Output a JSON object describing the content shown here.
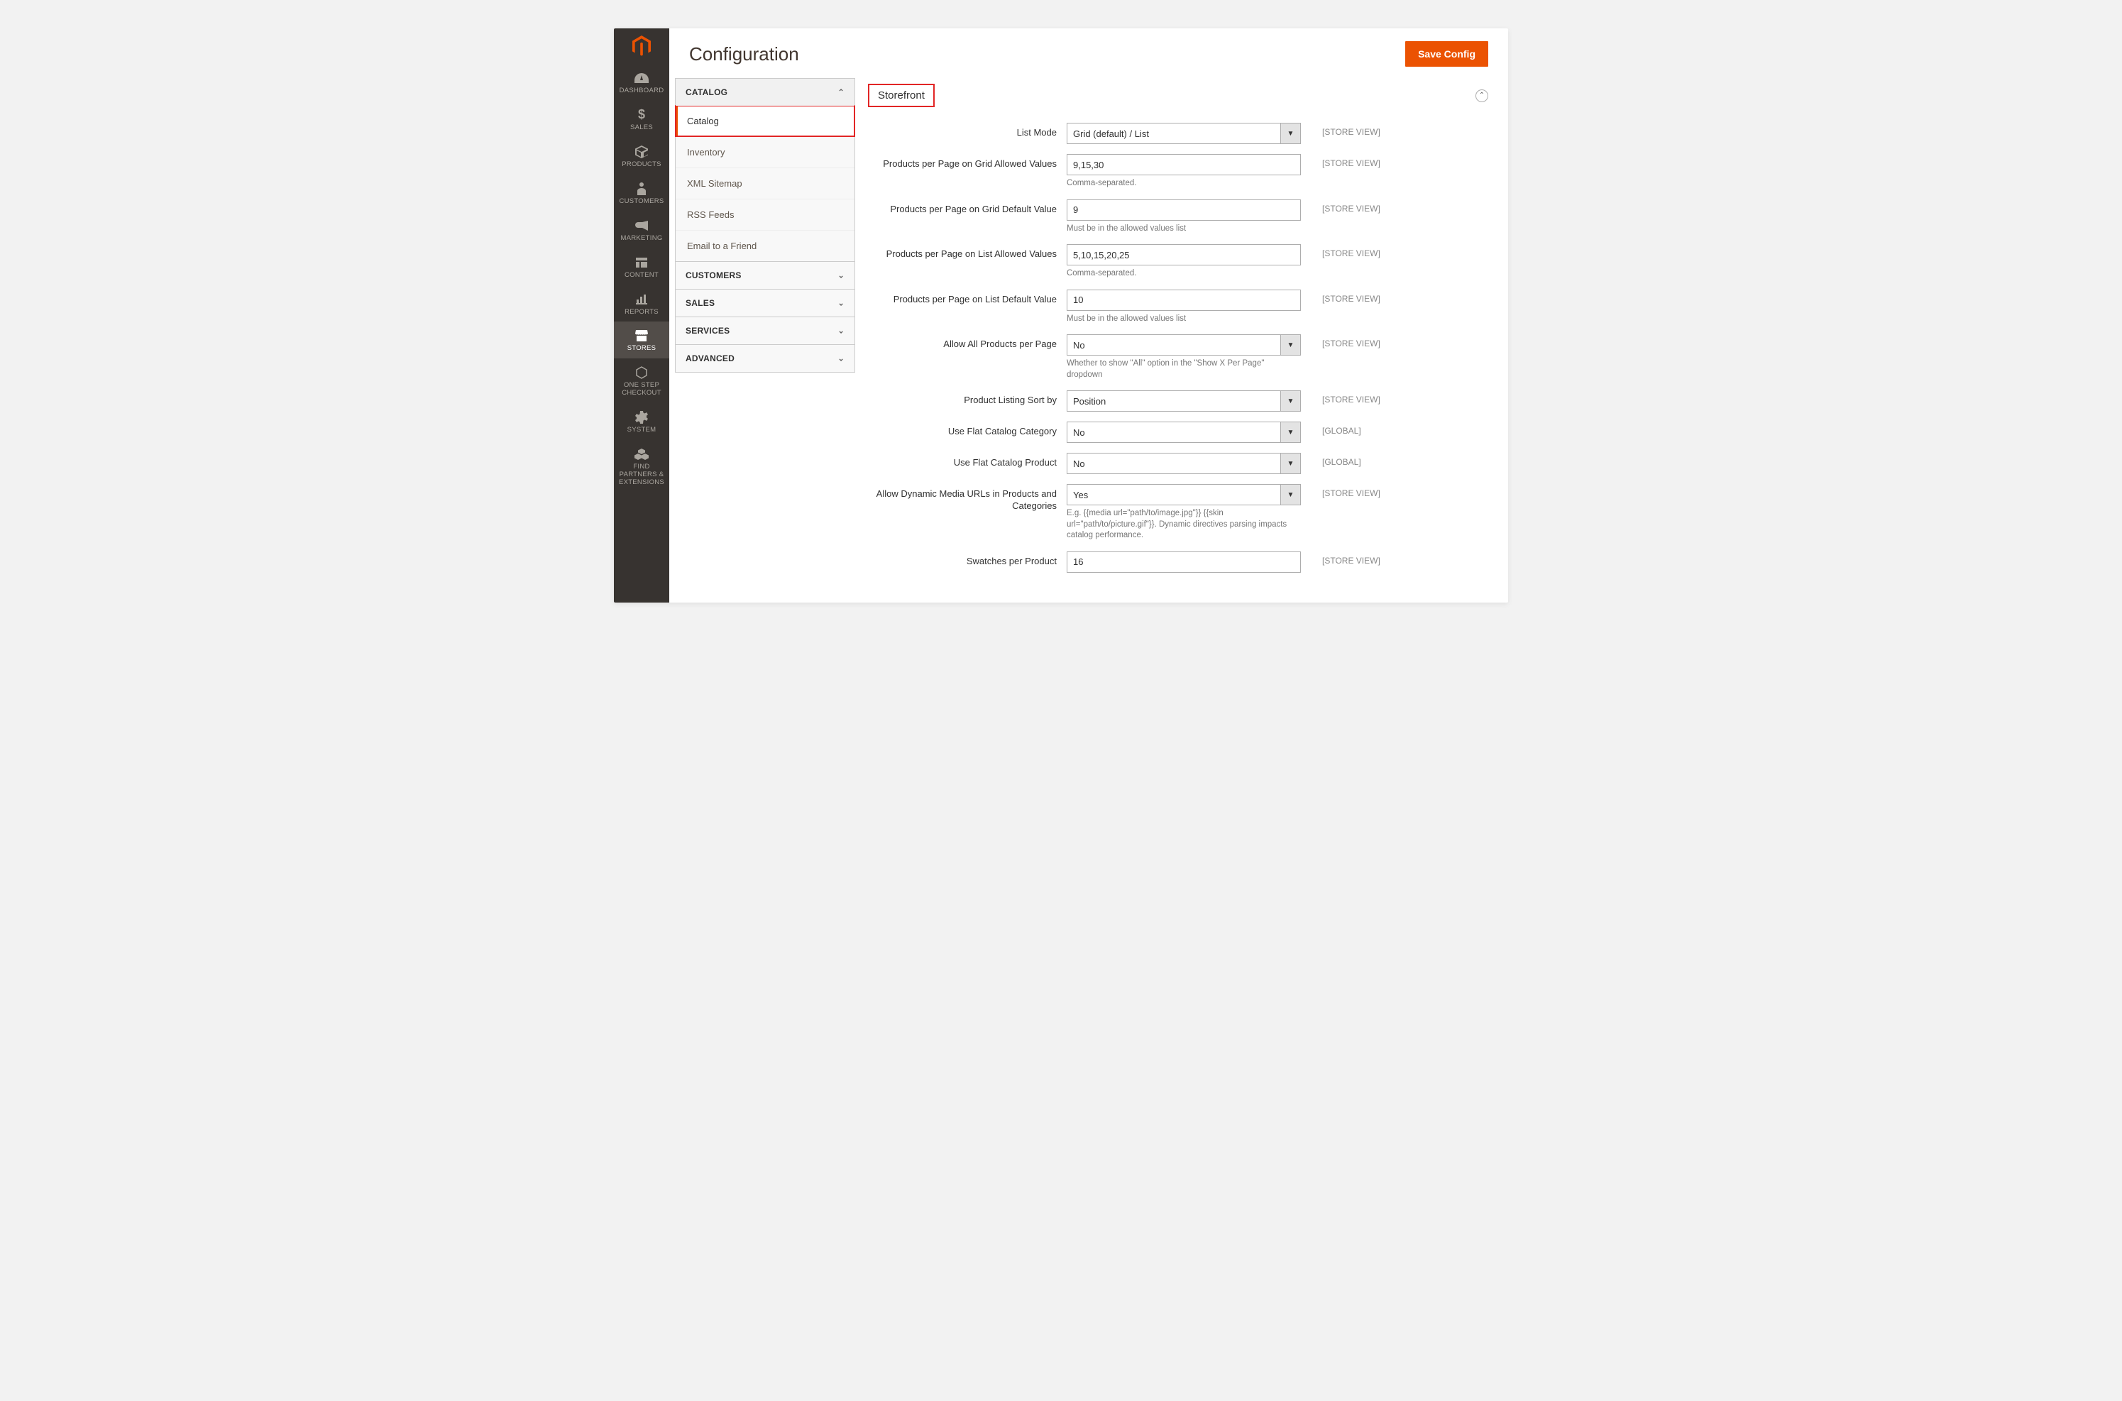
{
  "page": {
    "title": "Configuration",
    "save_button": "Save Config"
  },
  "sidebar": [
    {
      "label": "DASHBOARD",
      "icon": "dashboard"
    },
    {
      "label": "SALES",
      "icon": "dollar"
    },
    {
      "label": "PRODUCTS",
      "icon": "cube"
    },
    {
      "label": "CUSTOMERS",
      "icon": "person"
    },
    {
      "label": "MARKETING",
      "icon": "megaphone"
    },
    {
      "label": "CONTENT",
      "icon": "layout"
    },
    {
      "label": "REPORTS",
      "icon": "chart"
    },
    {
      "label": "STORES",
      "icon": "store",
      "active": true
    },
    {
      "label": "ONE STEP CHECKOUT",
      "icon": "hexagon"
    },
    {
      "label": "SYSTEM",
      "icon": "gear"
    },
    {
      "label": "FIND PARTNERS & EXTENSIONS",
      "icon": "cubes"
    }
  ],
  "config_nav": [
    {
      "label": "CATALOG",
      "expanded": true,
      "items": [
        {
          "label": "Catalog",
          "active": true,
          "highlight": true
        },
        {
          "label": "Inventory"
        },
        {
          "label": "XML Sitemap"
        },
        {
          "label": "RSS Feeds"
        },
        {
          "label": "Email to a Friend"
        }
      ]
    },
    {
      "label": "CUSTOMERS",
      "expanded": false
    },
    {
      "label": "SALES",
      "expanded": false
    },
    {
      "label": "SERVICES",
      "expanded": false
    },
    {
      "label": "ADVANCED",
      "expanded": false
    }
  ],
  "section": {
    "title": "Storefront"
  },
  "fields": {
    "list_mode": {
      "label": "List Mode",
      "value": "Grid (default) / List",
      "scope": "[STORE VIEW]"
    },
    "grid_allowed": {
      "label": "Products per Page on Grid Allowed Values",
      "value": "9,15,30",
      "note": "Comma-separated.",
      "scope": "[STORE VIEW]"
    },
    "grid_default": {
      "label": "Products per Page on Grid Default Value",
      "value": "9",
      "note": "Must be in the allowed values list",
      "scope": "[STORE VIEW]"
    },
    "list_allowed": {
      "label": "Products per Page on List Allowed Values",
      "value": "5,10,15,20,25",
      "note": "Comma-separated.",
      "scope": "[STORE VIEW]"
    },
    "list_default": {
      "label": "Products per Page on List Default Value",
      "value": "10",
      "note": "Must be in the allowed values list",
      "scope": "[STORE VIEW]"
    },
    "allow_all": {
      "label": "Allow All Products per Page",
      "value": "No",
      "note": "Whether to show \"All\" option in the \"Show X Per Page\" dropdown",
      "scope": "[STORE VIEW]"
    },
    "sort_by": {
      "label": "Product Listing Sort by",
      "value": "Position",
      "scope": "[STORE VIEW]"
    },
    "flat_category": {
      "label": "Use Flat Catalog Category",
      "value": "No",
      "scope": "[GLOBAL]"
    },
    "flat_product": {
      "label": "Use Flat Catalog Product",
      "value": "No",
      "scope": "[GLOBAL]"
    },
    "dynamic_media": {
      "label": "Allow Dynamic Media URLs in Products and Categories",
      "value": "Yes",
      "note": "E.g. {{media url=\"path/to/image.jpg\"}} {{skin url=\"path/to/picture.gif\"}}. Dynamic directives parsing impacts catalog performance.",
      "scope": "[STORE VIEW]"
    },
    "swatches": {
      "label": "Swatches per Product",
      "value": "16",
      "scope": "[STORE VIEW]"
    }
  }
}
